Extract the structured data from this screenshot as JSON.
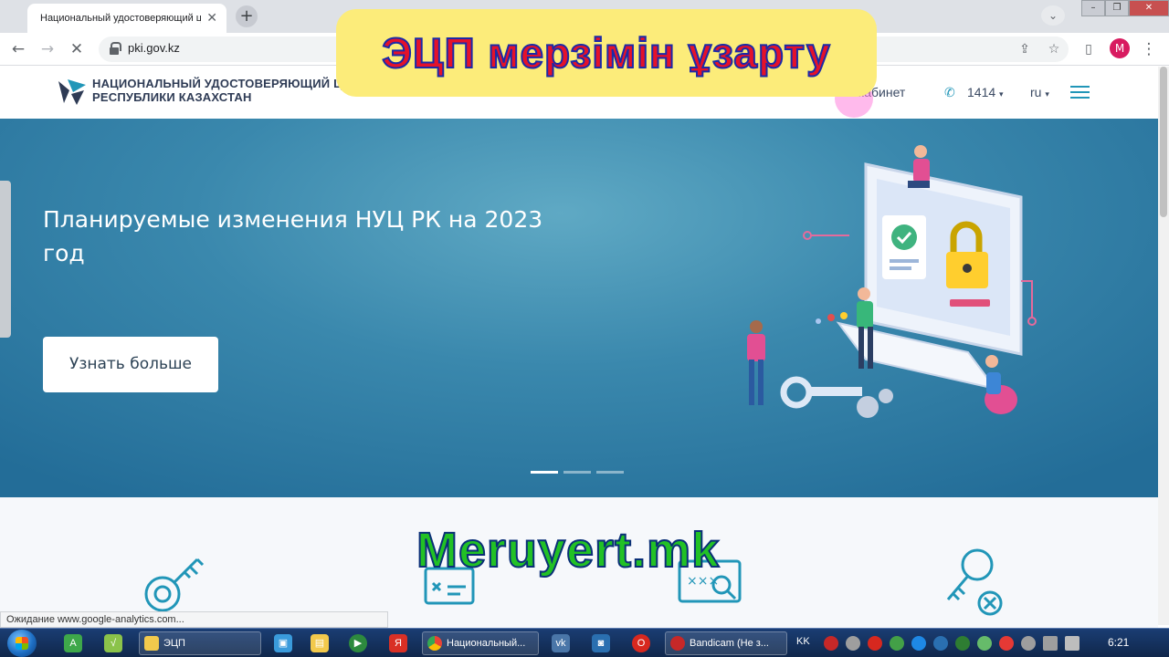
{
  "browser": {
    "tab_title": "Национальный удостоверяющий центр",
    "url": "pki.gov.kz",
    "profile_initial": "M"
  },
  "site": {
    "logo_line1": "НАЦИОНАЛЬНЫЙ УДОСТОВЕРЯЮЩИЙ ЦЕНТР",
    "logo_line2": "РЕСПУБЛИКИ КАЗАХСТАН",
    "cabinet_label": "Личный кабинет",
    "phone": "1414",
    "language": "ru",
    "accent_color": "#2196b8"
  },
  "hero": {
    "heading": "Планируемые изменения НУЦ РК на 2023 год",
    "button_label": "Узнать больше",
    "slides_count": 3,
    "active_slide": 1
  },
  "overlay": {
    "title": "ЭЦП мерзімін ұзарту",
    "watermark": "Meruyert.mk"
  },
  "status_text": "Ожидание www.google-analytics.com...",
  "taskbar": {
    "tasks": [
      "ЭЦП",
      "Национальный...",
      "Bandicam (Не з..."
    ],
    "language": "KK",
    "time": "6:21"
  }
}
